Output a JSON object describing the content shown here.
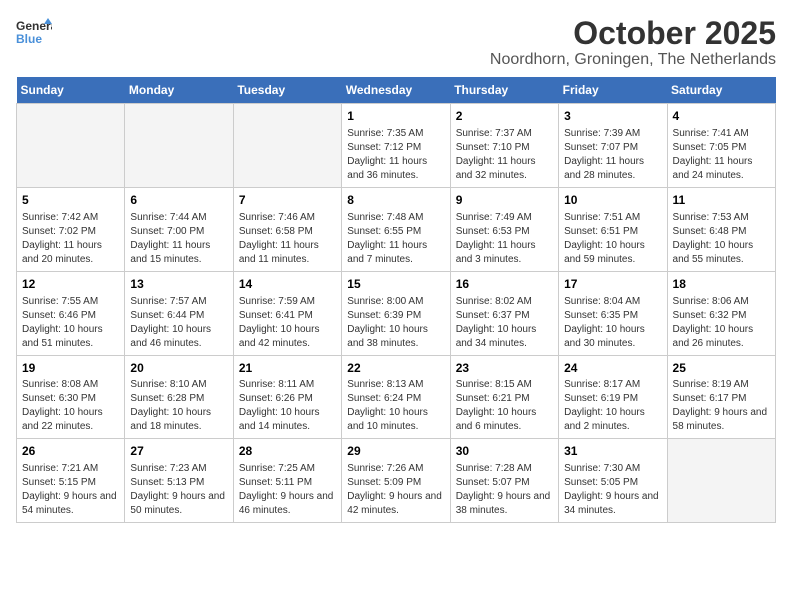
{
  "header": {
    "logo_line1": "General",
    "logo_line2": "Blue",
    "month": "October 2025",
    "location": "Noordhorn, Groningen, The Netherlands"
  },
  "weekdays": [
    "Sunday",
    "Monday",
    "Tuesday",
    "Wednesday",
    "Thursday",
    "Friday",
    "Saturday"
  ],
  "weeks": [
    [
      {
        "date": "",
        "info": ""
      },
      {
        "date": "",
        "info": ""
      },
      {
        "date": "",
        "info": ""
      },
      {
        "date": "1",
        "info": "Sunrise: 7:35 AM\nSunset: 7:12 PM\nDaylight: 11 hours and 36 minutes."
      },
      {
        "date": "2",
        "info": "Sunrise: 7:37 AM\nSunset: 7:10 PM\nDaylight: 11 hours and 32 minutes."
      },
      {
        "date": "3",
        "info": "Sunrise: 7:39 AM\nSunset: 7:07 PM\nDaylight: 11 hours and 28 minutes."
      },
      {
        "date": "4",
        "info": "Sunrise: 7:41 AM\nSunset: 7:05 PM\nDaylight: 11 hours and 24 minutes."
      }
    ],
    [
      {
        "date": "5",
        "info": "Sunrise: 7:42 AM\nSunset: 7:02 PM\nDaylight: 11 hours and 20 minutes."
      },
      {
        "date": "6",
        "info": "Sunrise: 7:44 AM\nSunset: 7:00 PM\nDaylight: 11 hours and 15 minutes."
      },
      {
        "date": "7",
        "info": "Sunrise: 7:46 AM\nSunset: 6:58 PM\nDaylight: 11 hours and 11 minutes."
      },
      {
        "date": "8",
        "info": "Sunrise: 7:48 AM\nSunset: 6:55 PM\nDaylight: 11 hours and 7 minutes."
      },
      {
        "date": "9",
        "info": "Sunrise: 7:49 AM\nSunset: 6:53 PM\nDaylight: 11 hours and 3 minutes."
      },
      {
        "date": "10",
        "info": "Sunrise: 7:51 AM\nSunset: 6:51 PM\nDaylight: 10 hours and 59 minutes."
      },
      {
        "date": "11",
        "info": "Sunrise: 7:53 AM\nSunset: 6:48 PM\nDaylight: 10 hours and 55 minutes."
      }
    ],
    [
      {
        "date": "12",
        "info": "Sunrise: 7:55 AM\nSunset: 6:46 PM\nDaylight: 10 hours and 51 minutes."
      },
      {
        "date": "13",
        "info": "Sunrise: 7:57 AM\nSunset: 6:44 PM\nDaylight: 10 hours and 46 minutes."
      },
      {
        "date": "14",
        "info": "Sunrise: 7:59 AM\nSunset: 6:41 PM\nDaylight: 10 hours and 42 minutes."
      },
      {
        "date": "15",
        "info": "Sunrise: 8:00 AM\nSunset: 6:39 PM\nDaylight: 10 hours and 38 minutes."
      },
      {
        "date": "16",
        "info": "Sunrise: 8:02 AM\nSunset: 6:37 PM\nDaylight: 10 hours and 34 minutes."
      },
      {
        "date": "17",
        "info": "Sunrise: 8:04 AM\nSunset: 6:35 PM\nDaylight: 10 hours and 30 minutes."
      },
      {
        "date": "18",
        "info": "Sunrise: 8:06 AM\nSunset: 6:32 PM\nDaylight: 10 hours and 26 minutes."
      }
    ],
    [
      {
        "date": "19",
        "info": "Sunrise: 8:08 AM\nSunset: 6:30 PM\nDaylight: 10 hours and 22 minutes."
      },
      {
        "date": "20",
        "info": "Sunrise: 8:10 AM\nSunset: 6:28 PM\nDaylight: 10 hours and 18 minutes."
      },
      {
        "date": "21",
        "info": "Sunrise: 8:11 AM\nSunset: 6:26 PM\nDaylight: 10 hours and 14 minutes."
      },
      {
        "date": "22",
        "info": "Sunrise: 8:13 AM\nSunset: 6:24 PM\nDaylight: 10 hours and 10 minutes."
      },
      {
        "date": "23",
        "info": "Sunrise: 8:15 AM\nSunset: 6:21 PM\nDaylight: 10 hours and 6 minutes."
      },
      {
        "date": "24",
        "info": "Sunrise: 8:17 AM\nSunset: 6:19 PM\nDaylight: 10 hours and 2 minutes."
      },
      {
        "date": "25",
        "info": "Sunrise: 8:19 AM\nSunset: 6:17 PM\nDaylight: 9 hours and 58 minutes."
      }
    ],
    [
      {
        "date": "26",
        "info": "Sunrise: 7:21 AM\nSunset: 5:15 PM\nDaylight: 9 hours and 54 minutes."
      },
      {
        "date": "27",
        "info": "Sunrise: 7:23 AM\nSunset: 5:13 PM\nDaylight: 9 hours and 50 minutes."
      },
      {
        "date": "28",
        "info": "Sunrise: 7:25 AM\nSunset: 5:11 PM\nDaylight: 9 hours and 46 minutes."
      },
      {
        "date": "29",
        "info": "Sunrise: 7:26 AM\nSunset: 5:09 PM\nDaylight: 9 hours and 42 minutes."
      },
      {
        "date": "30",
        "info": "Sunrise: 7:28 AM\nSunset: 5:07 PM\nDaylight: 9 hours and 38 minutes."
      },
      {
        "date": "31",
        "info": "Sunrise: 7:30 AM\nSunset: 5:05 PM\nDaylight: 9 hours and 34 minutes."
      },
      {
        "date": "",
        "info": ""
      }
    ]
  ]
}
